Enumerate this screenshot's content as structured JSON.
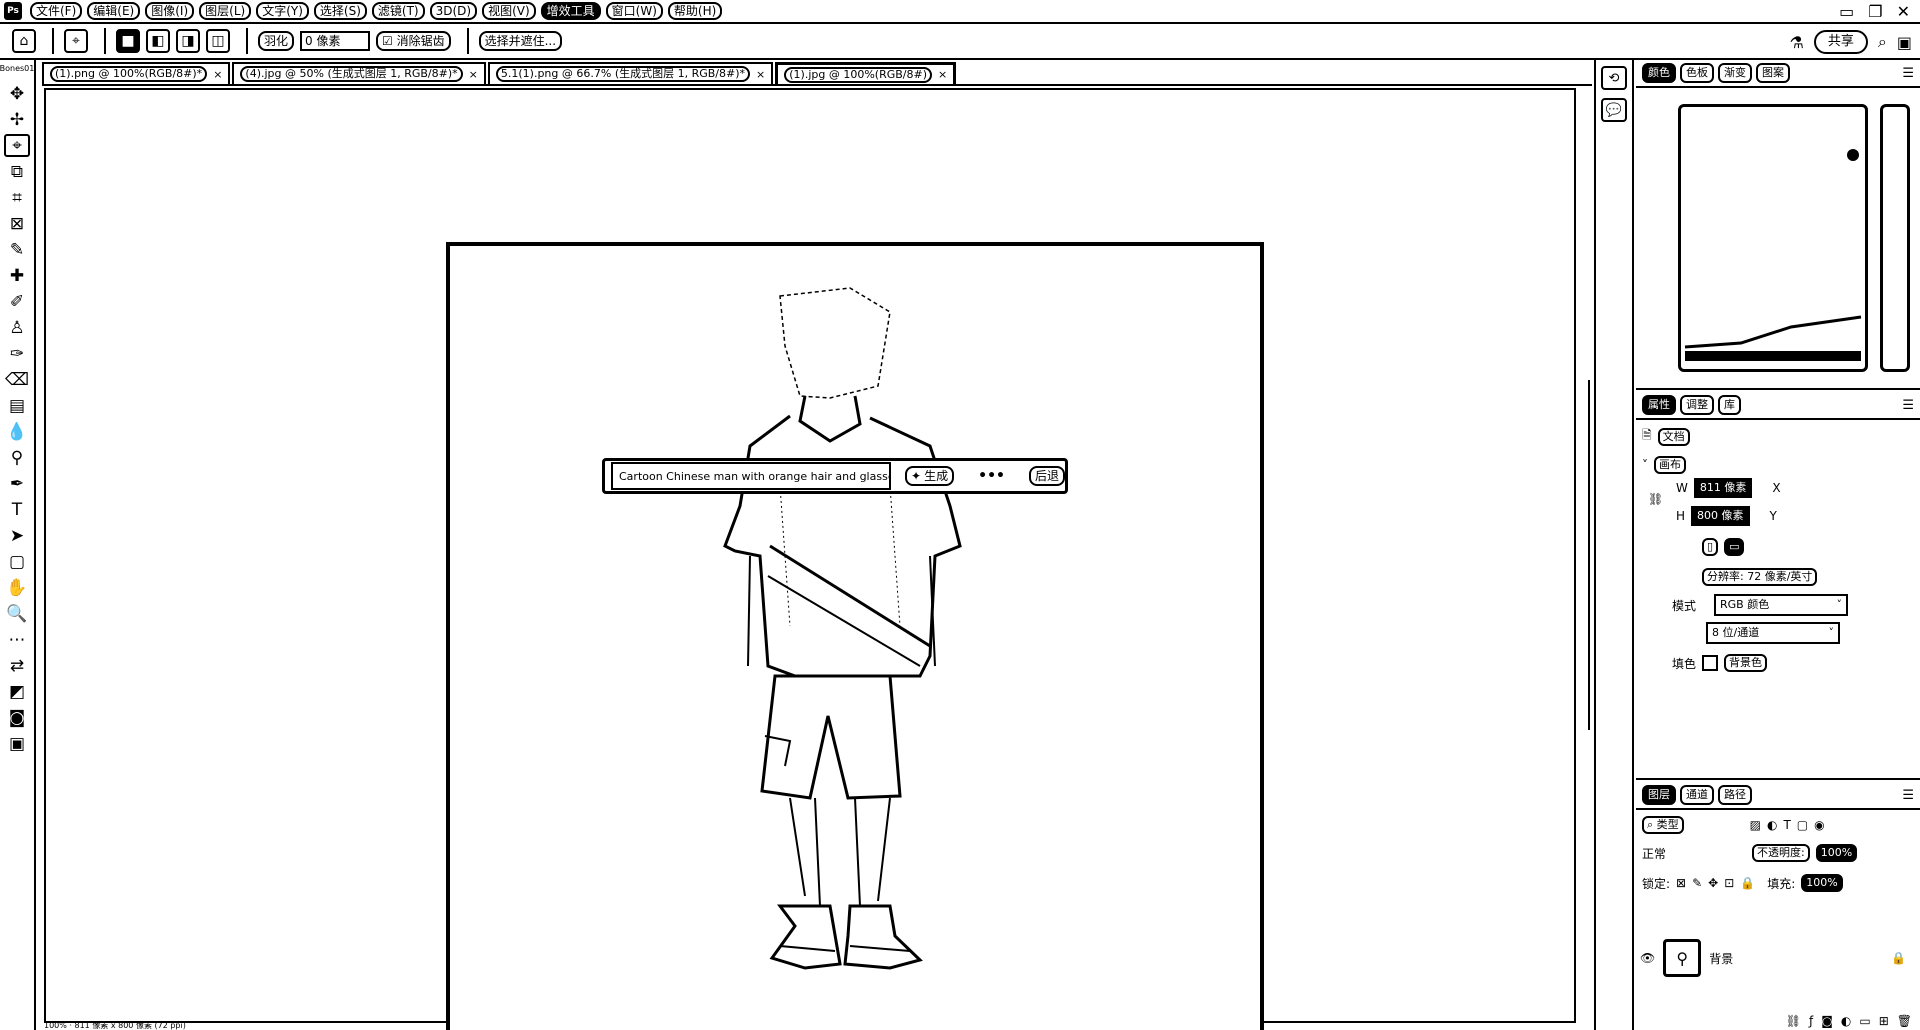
{
  "app": {
    "logo": "Ps"
  },
  "menubar": {
    "items": [
      "文件(F)",
      "编辑(E)",
      "图像(I)",
      "图层(L)",
      "文字(Y)",
      "选择(S)",
      "滤镜(T)",
      "3D(D)",
      "视图(V)",
      "增效工具",
      "窗口(W)",
      "帮助(H)"
    ],
    "active_index": 9
  },
  "options": {
    "feather_label": "羽化",
    "feather_value": "0 像素",
    "antialias_label": "消除锯齿",
    "select_mask_label": "选择并遮住...",
    "share_label": "共享"
  },
  "toolbar": {
    "header": "Bones01"
  },
  "tabs": [
    {
      "label": "(1).png @ 100%(RGB/8#)*",
      "active": false
    },
    {
      "label": "(4).jpg @ 50% (生成式图层 1, RGB/8#)*",
      "active": false
    },
    {
      "label": "5.1(1).png @ 66.7% (生成式图层 1, RGB/8#)*",
      "active": false
    },
    {
      "label": "(1).jpg @ 100%(RGB/8#)",
      "active": true
    }
  ],
  "generative": {
    "prompt": "Cartoon Chinese man with orange hair and glasses",
    "generate_label": "生成",
    "more_label": "•••",
    "back_label": "后退"
  },
  "panels": {
    "top_tabs": [
      "颜色",
      "色板",
      "渐变",
      "图案"
    ],
    "props_tabs": [
      "属性",
      "调整",
      "库"
    ],
    "doc_label": "文档",
    "canvas_section": "画布",
    "width_label": "W",
    "width_value": "811 像素",
    "height_label": "H",
    "height_value": "800 像素",
    "x_label": "X",
    "y_label": "Y",
    "resolution": "分辨率: 72 像素/英寸",
    "mode_label": "模式",
    "mode_value": "RGB 颜色",
    "depth_value": "8 位/通道",
    "fill_label": "填色",
    "fill_value": "背景色",
    "layers_tabs": [
      "图层",
      "通道",
      "路径"
    ],
    "kind_label": "类型",
    "blend_mode": "正常",
    "opacity_label": "不透明度:",
    "opacity_value": "100%",
    "lock_label": "锁定:",
    "fill_opacity_label": "填充:",
    "fill_opacity_value": "100%",
    "layer_name": "背景"
  },
  "status": {
    "text": "100% · 811 像素 x 800 像素 (72 ppi)"
  }
}
